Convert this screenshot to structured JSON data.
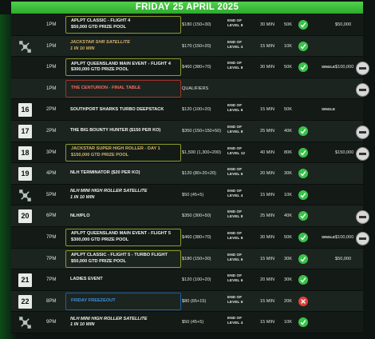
{
  "header": {
    "title": "FRIDAY 25 APRIL 2025"
  },
  "rows": [
    {
      "day": "",
      "icon": "",
      "time": "1PM",
      "event_l1": "APLPT CLASSIC - FLIGHT 4",
      "event_l2": "$50,000 GTD PRIZE POOL",
      "style": "white",
      "box": "boxed",
      "buyin": "$180 (150+30)",
      "reg": "END OF LEVEL 8",
      "levels": "30 MIN",
      "stack": "50K",
      "status": "ok",
      "type": "",
      "gtd": "$50,000",
      "badge": false,
      "bg": "plain"
    },
    {
      "day": "",
      "icon": "satellite-icon",
      "time": "1PM",
      "event_l1": "JACKSTAR SHR SATELLITE",
      "event_l2": "1 IN 10 WIN",
      "style": "gold italic",
      "box": "",
      "buyin": "$170 (150+20)",
      "reg": "END OF LEVEL 4",
      "levels": "15 MIN",
      "stack": "10K",
      "status": "ok",
      "type": "",
      "gtd": "",
      "badge": false,
      "bg": "alt"
    },
    {
      "day": "",
      "icon": "",
      "time": "1PM",
      "event_l1": "APLPT QUEENSLAND MAIN EVENT - FLIGHT 4",
      "event_l2": "$300,000 GTD PRIZE POOL",
      "style": "white",
      "box": "boxed",
      "buyin": "$460 (380+70)",
      "reg": "END OF LEVEL 8",
      "levels": "30 MIN",
      "stack": "50K",
      "status": "ok",
      "type": "SINGLE",
      "gtd": "$100,000",
      "badge": true,
      "bg": "plain"
    },
    {
      "day": "",
      "icon": "",
      "time": "1PM",
      "event_l1": "THE CENTURION - FINAL TABLE",
      "event_l2": "",
      "style": "red",
      "box": "boxed-red",
      "buyin": "QUALIFIERS",
      "reg": "",
      "levels": "",
      "stack": "",
      "status": "",
      "type": "",
      "gtd": "",
      "badge": true,
      "bg": "alt"
    },
    {
      "day": "16",
      "icon": "",
      "time": "2PM",
      "event_l1": "SOUTHPORT SHARKS TURBO DEEPSTACK",
      "event_l2": "",
      "style": "white",
      "box": "",
      "buyin": "$120 (100+20)",
      "reg": "END OF LEVEL 6",
      "levels": "15 MIN",
      "stack": "50K",
      "status": "",
      "type": "SINGLE",
      "gtd": "",
      "badge": false,
      "bg": "plain"
    },
    {
      "day": "17",
      "icon": "",
      "time": "2PM",
      "event_l1": "THE BIG BOUNTY HUNTER ($150 PER KO)",
      "event_l2": "",
      "style": "white",
      "box": "",
      "buyin": "$350 (150+150+50)",
      "reg": "END OF LEVEL 8",
      "levels": "25 MIN",
      "stack": "40K",
      "status": "ok",
      "type": "",
      "gtd": "",
      "badge": true,
      "bg": "alt"
    },
    {
      "day": "18",
      "icon": "",
      "time": "3PM",
      "event_l1": "JACKSTAR SUPER HIGH ROLLER - DAY 1",
      "event_l2": "$150,000 GTD PRIZE POOL",
      "style": "gold",
      "box": "boxed",
      "buyin": "$1,500 (1,300+200)",
      "reg": "END OF LEVEL 12",
      "levels": "40 MIN",
      "stack": "80K",
      "status": "ok",
      "type": "",
      "gtd": "$150,000",
      "badge": true,
      "bg": "plain"
    },
    {
      "day": "19",
      "icon": "",
      "time": "4PM",
      "event_l1": "NLH TERMINATOR ($20 PER KO)",
      "event_l2": "",
      "style": "white",
      "box": "",
      "buyin": "$120 (80+20+20)",
      "reg": "END OF LEVEL 6",
      "levels": "20 MIN",
      "stack": "30K",
      "status": "ok",
      "type": "",
      "gtd": "",
      "badge": false,
      "bg": "alt"
    },
    {
      "day": "",
      "icon": "satellite-icon",
      "time": "5PM",
      "event_l1": "NLH MINI HIGH ROLLER SATELLITE",
      "event_l2": "1 IN 10 WIN",
      "style": "white italic",
      "box": "",
      "buyin": "$50 (45+5)",
      "reg": "END OF LEVEL 4",
      "levels": "15 MIN",
      "stack": "10K",
      "status": "ok",
      "type": "",
      "gtd": "",
      "badge": false,
      "bg": "plain"
    },
    {
      "day": "20",
      "icon": "",
      "time": "6PM",
      "event_l1": "NLH/PLO",
      "event_l2": "",
      "style": "white",
      "box": "",
      "buyin": "$350 (300+50)",
      "reg": "END OF LEVEL 8",
      "levels": "25 MIN",
      "stack": "40K",
      "status": "ok",
      "type": "",
      "gtd": "",
      "badge": true,
      "bg": "alt"
    },
    {
      "day": "",
      "icon": "",
      "time": "7PM",
      "event_l1": "APLPT QUEENSLAND MAIN EVENT - FLIGHT 5",
      "event_l2": "$300,000 GTD PRIZE POOL",
      "style": "white",
      "box": "boxed",
      "buyin": "$460 (380+70)",
      "reg": "END OF LEVEL 8",
      "levels": "30 MIN",
      "stack": "50K",
      "status": "ok",
      "type": "SINGLE",
      "gtd": "$100,000",
      "badge": true,
      "bg": "plain"
    },
    {
      "day": "",
      "icon": "",
      "time": "7PM",
      "event_l1": "APLPT CLASSIC - FLIGHT 5 - TURBO FLIGHT",
      "event_l2": "$50,000 GTD PRIZE POOL",
      "style": "white",
      "box": "boxed",
      "buyin": "$180 (150+30)",
      "reg": "END OF LEVEL 6",
      "levels": "15 MIN",
      "stack": "30K",
      "status": "ok",
      "type": "",
      "gtd": "$50,000",
      "badge": false,
      "bg": "alt"
    },
    {
      "day": "21",
      "icon": "",
      "time": "7PM",
      "event_l1": "LADIES EVENT",
      "event_l2": "",
      "style": "white",
      "box": "",
      "buyin": "$120 (100+20)",
      "reg": "END OF LEVEL 6",
      "levels": "20 MIN",
      "stack": "30K",
      "status": "ok",
      "type": "",
      "gtd": "",
      "badge": false,
      "bg": "plain"
    },
    {
      "day": "22",
      "icon": "",
      "time": "8PM",
      "event_l1": "FRIDAY FREEZEOUT",
      "event_l2": "",
      "style": "blue",
      "box": "boxed-blue",
      "buyin": "$80 (65+15)",
      "reg": "END OF LEVEL 6",
      "levels": "15 MIN",
      "stack": "20K",
      "status": "no",
      "type": "",
      "gtd": "",
      "badge": false,
      "bg": "alt"
    },
    {
      "day": "",
      "icon": "satellite-icon",
      "time": "9PM",
      "event_l1": "NLH MINI HIGH ROLLER SATELLITE",
      "event_l2": "1 IN 10 WIN",
      "style": "white italic",
      "box": "",
      "buyin": "$50 (45+5)",
      "reg": "END OF LEVEL 4",
      "levels": "15 MIN",
      "stack": "10K",
      "status": "ok",
      "type": "",
      "gtd": "",
      "badge": false,
      "bg": "plain"
    }
  ]
}
